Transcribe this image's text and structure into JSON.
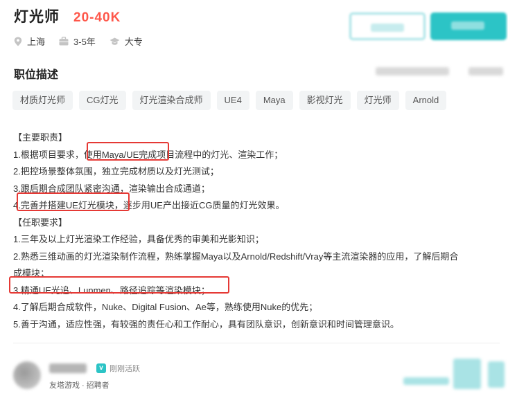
{
  "header": {
    "title": "灯光师",
    "salary": "20-40K"
  },
  "meta": {
    "location": "上海",
    "experience": "3-5年",
    "education": "大专"
  },
  "section": {
    "title": "职位描述"
  },
  "tags": [
    "材质灯光师",
    "CG灯光",
    "灯光渲染合成师",
    "UE4",
    "Maya",
    "影视灯光",
    "灯光师",
    "Arnold"
  ],
  "description": {
    "lines": [
      "【主要职责】",
      "1.根据项目要求，使用Maya/UE完成项目流程中的灯光、渲染工作；",
      "2.把控场景整体氛围，独立完成材质以及灯光测试；",
      "3.跟后期合成团队紧密沟通，渲染输出合成通道；",
      "4.完善并搭建UE灯光模块，逐步用UE产出接近CG质量的灯光效果。",
      "【任职要求】",
      "1.三年及以上灯光渲染工作经验，具备优秀的审美和光影知识；",
      "2.熟悉三维动画的灯光渲染制作流程，熟练掌握Maya以及Arnold/Redshift/Vray等主流渲染器的应用，了解后期合",
      "成模块；",
      "3.精通UE光追、Lunmen、路径追踪等渲染模块；",
      "4.了解后期合成软件，Nuke、Digital Fusion、Ae等，熟练使用Nuke的优先；",
      "5.善于沟通，适应性强，有较强的责任心和工作耐心，具有团队意识，创新意识和时间管理意识。"
    ]
  },
  "recruiter": {
    "status": "刚刚活跃",
    "company": "友塔游戏",
    "role": "招聘者"
  },
  "colors": {
    "accent": "#2cc4c6",
    "salary": "#fe574a",
    "highlight": "#e53935"
  }
}
